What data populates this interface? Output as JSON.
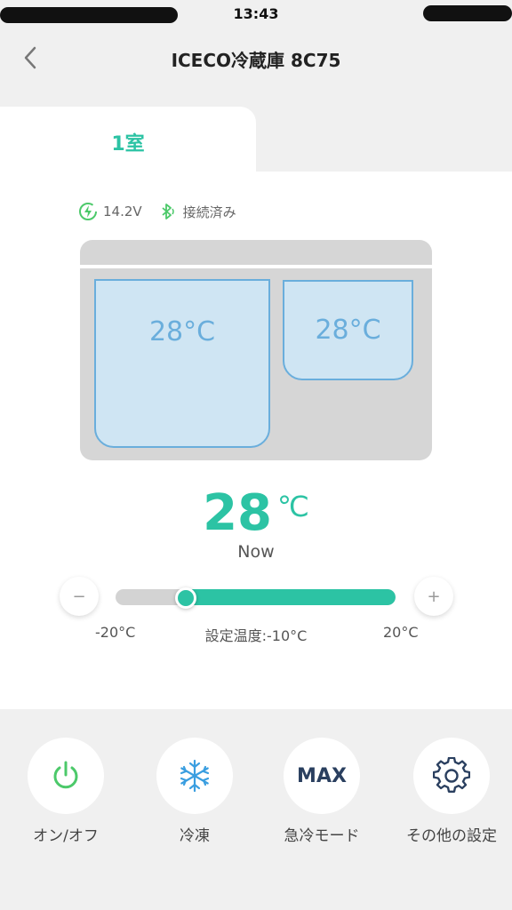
{
  "status_bar": {
    "time": "13:43"
  },
  "header": {
    "title": "ICECO冷蔵庫 8C75"
  },
  "tabs": [
    {
      "label": "1室"
    }
  ],
  "info": {
    "voltage": "14.2V",
    "bluetooth_status": "接続済み"
  },
  "zones": [
    {
      "temp": "28°C"
    },
    {
      "temp": "28°C"
    }
  ],
  "current": {
    "value": "28",
    "unit": "℃",
    "label": "Now"
  },
  "slider": {
    "min_label": "-20°C",
    "max_label": "20°C",
    "set_label": "設定温度:-10°C",
    "min": -20,
    "max": 20,
    "value": -10,
    "minus": "−",
    "plus": "+"
  },
  "actions": [
    {
      "label": "オン/オフ",
      "icon": "power-icon"
    },
    {
      "label": "冷凍",
      "icon": "snowflake-icon"
    },
    {
      "label": "急冷モード",
      "icon_text": "MAX"
    },
    {
      "label": "その他の設定",
      "icon": "gear-icon"
    }
  ],
  "colors": {
    "accent": "#2cc3a4",
    "zone_blue": "#6aaedc",
    "power_green": "#4cc96a"
  }
}
